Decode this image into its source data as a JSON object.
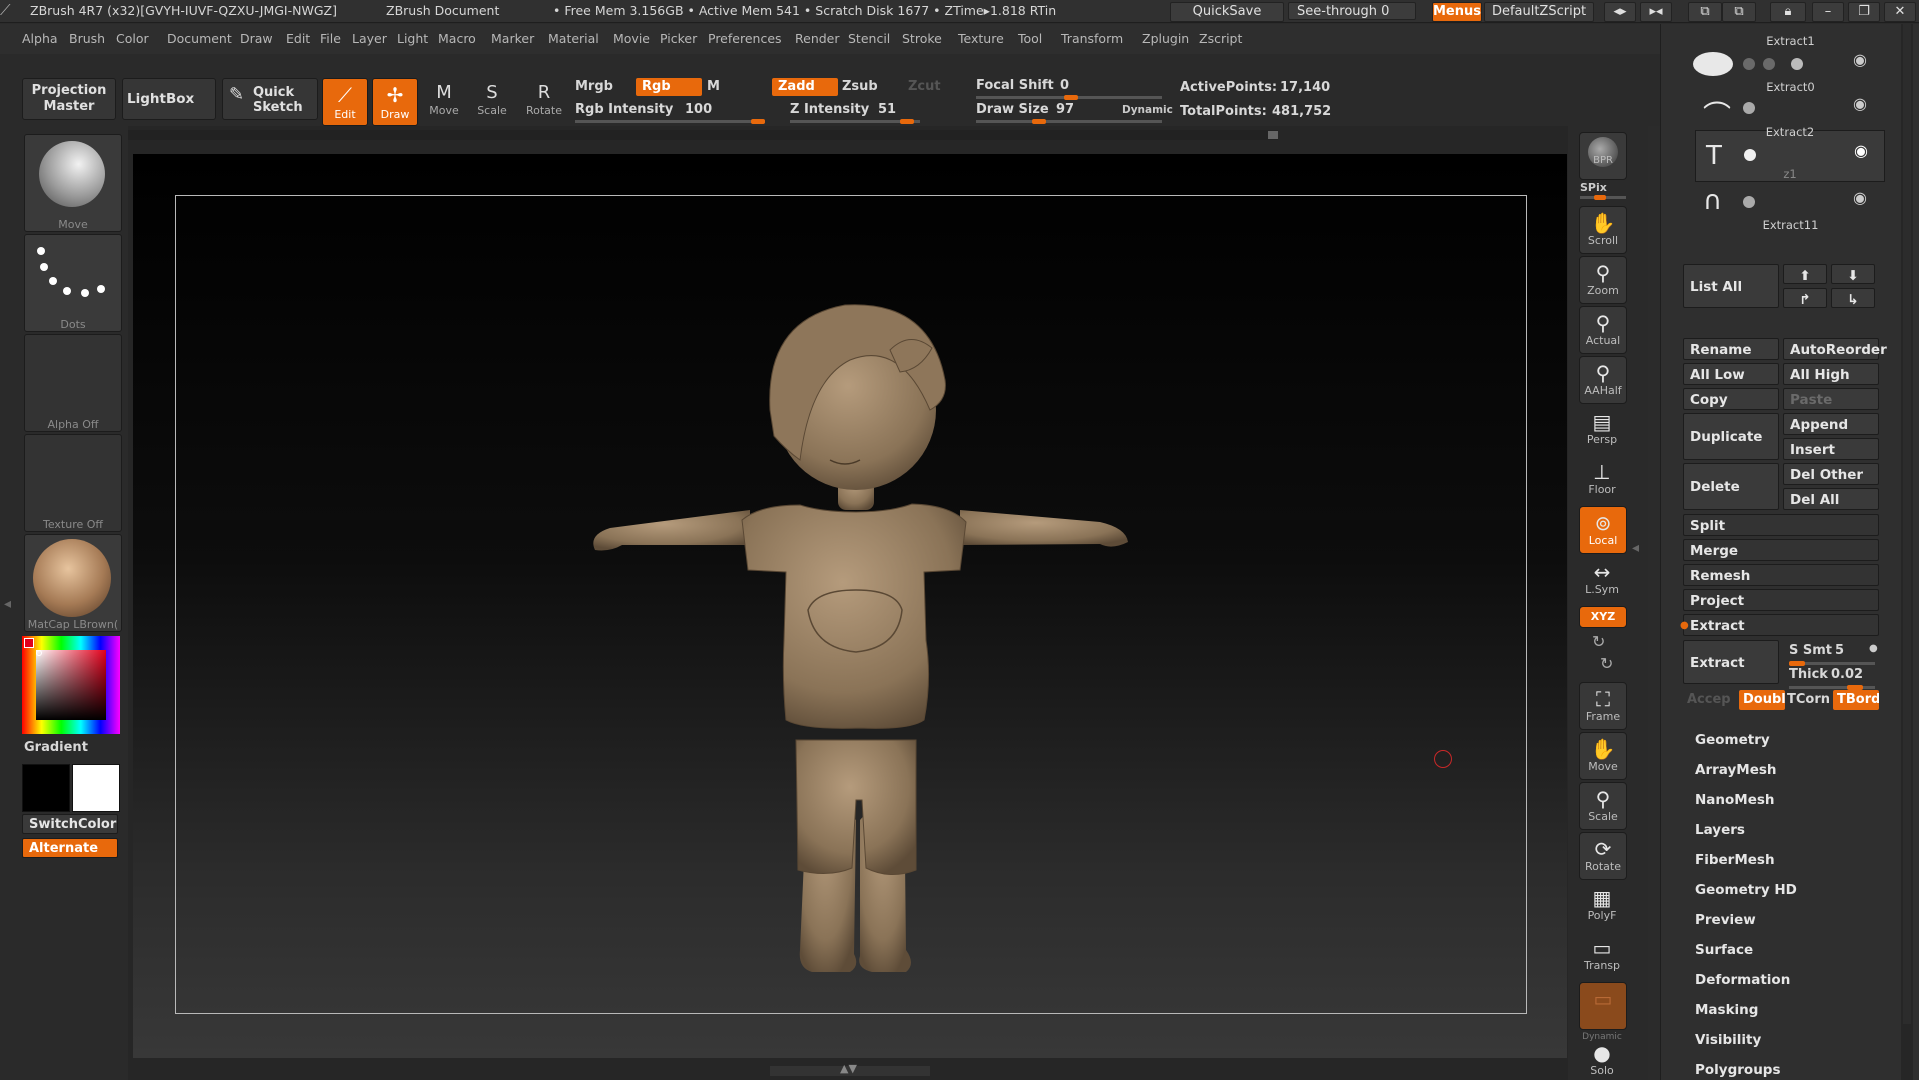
{
  "titlebar": {
    "app": "ZBrush 4R7 (x32)[GVYH-IUVF-QZXU-JMGI-NWGZ]",
    "doc": "ZBrush Document",
    "stats": "• Free Mem 3.156GB • Active Mem 541 • Scratch Disk 1677 • ZTime▸1.818 RTin",
    "quicksave": "QuickSave",
    "seethrough": "See-through  0",
    "menus": "Menus",
    "script": "DefaultZScript"
  },
  "menubar": [
    "Alpha",
    "Brush",
    "Color",
    "Document",
    "Draw",
    "Edit",
    "File",
    "Layer",
    "Light",
    "Macro",
    "Marker",
    "Material",
    "Movie",
    "Picker",
    "Preferences",
    "Render",
    "Stencil",
    "Stroke",
    "Texture",
    "Tool",
    "Transform",
    "Zplugin",
    "Zscript"
  ],
  "toolbar": {
    "projection_master": "Projection Master",
    "lightbox": "LightBox",
    "quick_sketch": "Quick Sketch",
    "edit": "Edit",
    "draw": "Draw",
    "move": "Move",
    "scale": "Scale",
    "rotate": "Rotate",
    "mrgb": "Mrgb",
    "rgb": "Rgb",
    "m": "M",
    "zadd": "Zadd",
    "zsub": "Zsub",
    "zcut": "Zcut",
    "rgb_intensity_label": "Rgb  Intensity",
    "rgb_intensity": "100",
    "z_intensity_label": "Z  Intensity",
    "z_intensity": "51",
    "focal_shift_label": "Focal  Shift",
    "focal_shift": "0",
    "draw_size_label": "Draw  Size",
    "draw_size": "97",
    "dynamic": "Dynamic",
    "active_points_label": "ActivePoints:",
    "active_points": "17,140",
    "total_points_label": "TotalPoints:",
    "total_points": "481,752"
  },
  "leftshelf": {
    "brush": "Move",
    "stroke": "Dots",
    "alpha": "Alpha  Off",
    "texture": "Texture  Off",
    "material": "MatCap  LBrown(",
    "gradient": "Gradient",
    "switchcolor": "SwitchColor",
    "alternate": "Alternate"
  },
  "rightshelf": [
    {
      "name": "bpr",
      "label": "BPR"
    },
    {
      "name": "spix",
      "label": "SPix"
    },
    {
      "name": "scroll",
      "label": "Scroll"
    },
    {
      "name": "zoom",
      "label": "Zoom"
    },
    {
      "name": "actual",
      "label": "Actual"
    },
    {
      "name": "aahalf",
      "label": "AAHalf"
    },
    {
      "name": "persp",
      "label": "Persp"
    },
    {
      "name": "floor",
      "label": "Floor"
    },
    {
      "name": "local",
      "label": "Local"
    },
    {
      "name": "lsym",
      "label": "L.Sym"
    },
    {
      "name": "xyz",
      "label": "XYZ"
    },
    {
      "name": "frame",
      "label": "Frame"
    },
    {
      "name": "move",
      "label": "Move"
    },
    {
      "name": "scale",
      "label": "Scale"
    },
    {
      "name": "rotate",
      "label": "Rotate"
    },
    {
      "name": "polyf",
      "label": "PolyF"
    },
    {
      "name": "transp",
      "label": "Transp"
    },
    {
      "name": "solo",
      "label": "Solo"
    },
    {
      "name": "dynamic",
      "label": "Dynamic"
    }
  ],
  "panel": {
    "subtools": [
      "Extract1",
      "Extract0",
      "Extract2",
      "z1",
      "Extract11"
    ],
    "list_all": "List  All",
    "rename": "Rename",
    "autoreorder": "AutoReorder",
    "all_low": "All  Low",
    "all_high": "All  High",
    "copy": "Copy",
    "paste": "Paste",
    "duplicate": "Duplicate",
    "append": "Append",
    "insert": "Insert",
    "delete": "Delete",
    "del_other": "Del  Other",
    "del_all": "Del  All",
    "split": "Split",
    "merge": "Merge",
    "remesh": "Remesh",
    "project": "Project",
    "extract_section": "Extract",
    "extract_button": "Extract",
    "s_smt_label": "S  Smt",
    "s_smt": "5",
    "thick_label": "Thick",
    "thick": "0.02",
    "accept": "Accep",
    "double": "Doubl",
    "tcorner": "TCorn",
    "tborder": "TBord",
    "sections": [
      "Geometry",
      "ArrayMesh",
      "NanoMesh",
      "Layers",
      "FiberMesh",
      "Geometry HD",
      "Preview",
      "Surface",
      "Deformation",
      "Masking",
      "Visibility",
      "Polygroups"
    ]
  },
  "colors": {
    "accent": "#e8690c",
    "model": "#9b8468"
  }
}
